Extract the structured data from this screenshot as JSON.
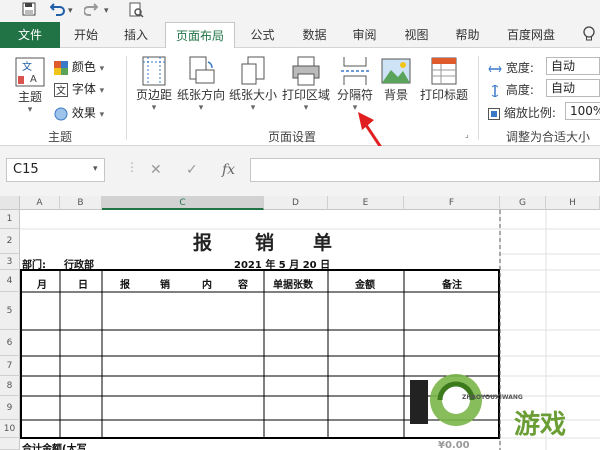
{
  "tabs": [
    "文件",
    "开始",
    "插入",
    "页面布局",
    "公式",
    "数据",
    "审阅",
    "视图",
    "帮助",
    "百度网盘"
  ],
  "ribbon": {
    "theme": {
      "themes_label": "主题",
      "colors_label": "颜色",
      "fonts_label": "字体",
      "effects_label": "效果",
      "group_label": "主题"
    },
    "page_setup": {
      "margins_label": "页边距",
      "orientation_label": "纸张方向",
      "size_label": "纸张大小",
      "print_area_label": "打印区域",
      "breaks_label": "分隔符",
      "background_label": "背景",
      "print_titles_label": "打印标题",
      "group_label": "页面设置"
    },
    "scale": {
      "width_label": "宽度:",
      "width_value": "自动",
      "height_label": "高度:",
      "height_value": "自动",
      "scale_label": "缩放比例:",
      "scale_value": "100%",
      "group_label": "调整为合适大小"
    }
  },
  "formula_bar": {
    "name_box": "C15",
    "fx_label": "fx",
    "formula_value": ""
  },
  "columns": [
    "A",
    "B",
    "C",
    "D",
    "E",
    "F",
    "G",
    "H"
  ],
  "rows": [
    "1",
    "2",
    "3",
    "4",
    "5",
    "6",
    "7",
    "8",
    "9",
    "10"
  ],
  "sheet": {
    "title_chars": [
      "报",
      "销",
      "单"
    ],
    "dept_label": "部门:",
    "dept_value": "行政部",
    "date": "2021 年 5 月 20 日",
    "headers": {
      "month": "月",
      "day": "日",
      "summary": [
        "报",
        "销",
        "内",
        "容"
      ],
      "docs": "单据张数",
      "amount": "金额",
      "remark": "备注"
    },
    "total_label": "合计金额(大写",
    "total_amount": "¥0.00"
  },
  "watermark": {
    "main": "游戏",
    "sub": "ZHAOYOUXIWANG"
  }
}
